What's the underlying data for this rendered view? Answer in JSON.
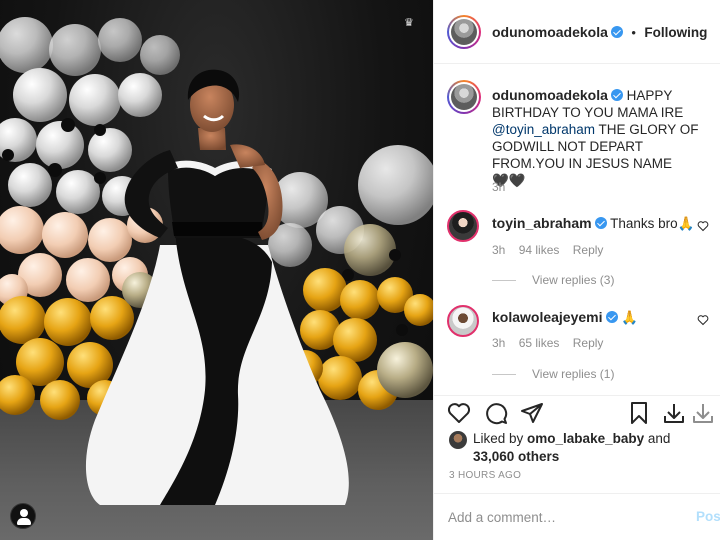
{
  "post": {
    "image_alt": "Woman in black and white gown posing in front of balloon backdrop",
    "icons": {
      "user_tag": "person-icon",
      "watermark": "crown-icon"
    }
  },
  "header": {
    "username": "odunomoadekola",
    "separator": "•",
    "follow_label": "Following"
  },
  "caption": {
    "username": "odunomoadekola",
    "text_before_mention": "HAPPY BIRTHDAY TO YOU MAMA IRE ",
    "mention": "@toyin_abraham",
    "text_after_mention": " THE GLORY OF GODWILL NOT DEPART FROM.YOU IN JESUS NAME",
    "emoji": "🖤🖤",
    "time": "3h"
  },
  "comments": [
    {
      "username": "toyin_abraham",
      "text": "Thanks bro🙏",
      "time": "3h",
      "likes": "94 likes",
      "reply_label": "Reply",
      "view_replies": "View replies (3)"
    },
    {
      "username": "kolawoleajeyemi",
      "text": "🙏",
      "time": "3h",
      "likes": "65 likes",
      "reply_label": "Reply",
      "view_replies": "View replies (1)"
    }
  ],
  "likes": {
    "prefix": "Liked by ",
    "user": "omo_labake_baby",
    "middle": " and",
    "count": "33,060 others"
  },
  "time_ago": "3 HOURS AGO",
  "comment_input": {
    "placeholder": "Add a comment…",
    "post_label": "Post"
  },
  "colors": {
    "verified": "#3897f0",
    "link": "#00376b",
    "muted": "#8e8e8e",
    "post_disabled": "#b2dffc"
  }
}
